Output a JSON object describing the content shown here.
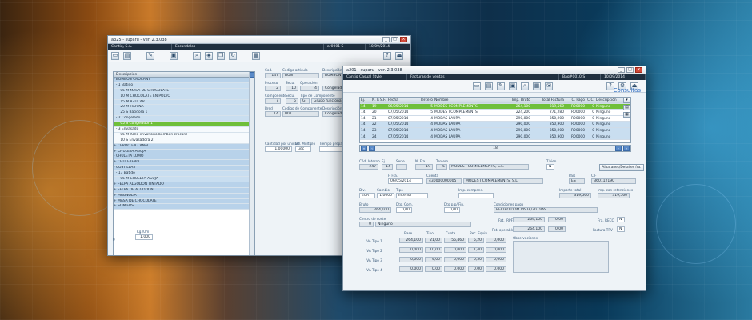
{
  "window1": {
    "title": "a325 - suparu - ver. 2.3.038",
    "info": [
      "Cantiq, S.A.",
      "Escandalos",
      "ar0001 S",
      "10/09/2014"
    ],
    "brand": "Consultas",
    "tree": {
      "header": "Descripción",
      "rows": [
        {
          "text": "- BOMBON CROCANT",
          "kind": "lvl0"
        },
        {
          "text": "  - 1 Batido",
          "kind": ""
        },
        {
          "text": "      05 M MASA DE CHOCOLATE",
          "kind": ""
        },
        {
          "text": "      10 M CHOCOLATE EN POLVO",
          "kind": ""
        },
        {
          "text": "      15 M AZUCAR",
          "kind": ""
        },
        {
          "text": "      20 M HARINA",
          "kind": ""
        },
        {
          "text": "      25 S Batidora 1",
          "kind": ""
        },
        {
          "text": "  - 2 Congelado",
          "kind": ""
        },
        {
          "text": "      05 S Congelador 1",
          "kind": "sel"
        },
        {
          "text": "  - 3 Envasado",
          "kind": "white"
        },
        {
          "text": "      05 M Rollo envoltorio bombon crocant",
          "kind": "white"
        },
        {
          "text": "      10 S Envasadora 2",
          "kind": "white"
        },
        {
          "text": "+ CERDO EN CANAL",
          "kind": "lvl0"
        },
        {
          "text": "+ CHULETA AGUJA",
          "kind": "lvl0"
        },
        {
          "text": "- CHULETA LOMO",
          "kind": "lvl0"
        },
        {
          "text": "+ CHULETERO",
          "kind": "lvl0"
        },
        {
          "text": "- COSTILLAS",
          "kind": "lvl0"
        },
        {
          "text": "  - 13 Batido",
          "kind": ""
        },
        {
          "text": "      05 M CHULETA AGUJA",
          "kind": ""
        },
        {
          "text": "+ FELPA ALGODON TINTADO",
          "kind": "lvl0"
        },
        {
          "text": "+ FELPA DE ALGODON",
          "kind": "lvl0"
        },
        {
          "text": "+ MAGNOLIA",
          "kind": "lvl0"
        },
        {
          "text": "+ MASA DE CHOCOLATE",
          "kind": "lvl0"
        },
        {
          "text": "+ SOMIERS",
          "kind": "lvl0"
        }
      ],
      "page": "25"
    },
    "fields": {
      "cod_label": "Cod.",
      "cod": "147",
      "codart_label": "Código artículo",
      "codart": "BON",
      "desc_label": "Descripción",
      "desc": "BOMBON CROCANT",
      "proceso_label": "Proceso",
      "proceso": "2",
      "secu_label": "Secu.",
      "secu": "10",
      "operacion_label": "Operación",
      "operacion_num": "4",
      "operacion": "Congelado",
      "componente_label": "Componente",
      "componente": "7",
      "secu2_label": "Secu.",
      "secu2": "5",
      "tipo_label": "Tipo de Componente",
      "tipo_num": "G",
      "tipo": "Grupo funcional hom",
      "bred_label": "Bred",
      "bred": "14",
      "codcomp_label": "Código de Componente",
      "codcomp": "001",
      "desccomp_label": "Descripción",
      "desccomp": "Congelador 1",
      "cant_label": "Cantidad por unidad",
      "cant": "1,00000",
      "ud_label": "Ud. Múltiplo",
      "ud": "udc",
      "tiempo_label": "Tiempo preparac.",
      "left_val": "0",
      "kg_label": "Kg./Um",
      "kg": "1,000"
    }
  },
  "window2": {
    "title": "a201 - suparu - ver. 2.3.038",
    "info": [
      "Cantiq Casual Style",
      "Facturas de ventas",
      "Bag#0010 S",
      "10/09/2014"
    ],
    "brand": "Consultas",
    "grid": {
      "head": [
        "Ej.",
        "N. Fac",
        "S.F.",
        "Fecha",
        "Tercero",
        "Nombre",
        "Imp. Bruto",
        "Total Factura",
        "C. Pago",
        "C.C.",
        "Descripción"
      ],
      "rows": [
        {
          "kind": "sel",
          "c": [
            "14",
            "19",
            "",
            "06/05/2014",
            "5",
            "MODES I COMPLEMENTS,",
            "264,100",
            "319,560",
            "R00000",
            "0",
            "Ninguno"
          ]
        },
        {
          "kind": "",
          "c": [
            "14",
            "20",
            "",
            "07/05/2014",
            "5",
            "MODES I COMPLEMENTS,",
            "224,200",
            "271,280",
            "R00000",
            "0",
            "Ninguno"
          ]
        },
        {
          "kind": "",
          "c": [
            "14",
            "21",
            "",
            "07/05/2014",
            "4",
            "MODAS LAURA",
            "290,000",
            "350,900",
            "R00000",
            "0",
            "Ninguno"
          ]
        },
        {
          "kind": "alt",
          "c": [
            "14",
            "22",
            "",
            "07/05/2014",
            "4",
            "MODAS LAURA",
            "290,000",
            "350,900",
            "R00000",
            "0",
            "Ninguno"
          ]
        },
        {
          "kind": "alt",
          "c": [
            "14",
            "23",
            "",
            "07/05/2014",
            "4",
            "MODAS LAURA",
            "290,000",
            "350,900",
            "R00000",
            "0",
            "Ninguno"
          ]
        },
        {
          "kind": "alt",
          "c": [
            "14",
            "24",
            "",
            "07/05/2014",
            "4",
            "MODAS LAURA",
            "290,000",
            "350,900",
            "R00000",
            "0",
            "Ninguno"
          ]
        }
      ],
      "page": "18"
    },
    "fields": {
      "cod_label": "Cód. Interno",
      "cod": "247",
      "ej_label": "Ej.",
      "ej": "14",
      "serie_label": "Serie",
      "nfra_label": "N. Fra.",
      "nfra": "19",
      "tercero_label": "Tercero",
      "tercero_num": "5",
      "tercero": "MODES I COMPLEMENTS, S.L.",
      "tbien_label": "T.bien",
      "tbien": "N",
      "albaranes_btn": "Albaranes/Detalles fra.",
      "ffra_label": "F. Fra.",
      "ffra": "06/05/2014",
      "cuenta_label": "Cuenta",
      "cuenta": "430000000005",
      "cuenta_name": "MODES I COMPLEMENTS, S.L.",
      "pais_label": "País",
      "pais": "ES",
      "cif_label": "CIF",
      "cif": "B60112190",
      "div_label": "Div.",
      "div": "EUR",
      "cambio_label": "Cambio",
      "cambio": "1,0000",
      "tipo_label": "Tipo",
      "tipo": "Interior",
      "impcompens_label": "Imp. compens.",
      "impfac_label": "Importe total",
      "impfac": "319,560",
      "impret_label": "Imp. con retenciones",
      "impret": "319,560",
      "bruto_label": "Bruto",
      "bruto": "264,100",
      "dtocom_label": "Dto. Com.",
      "dtocom": "0,00",
      "dtopp_label": "Dto p.p/ Fin.",
      "dtopp": "0,00",
      "condpago_label": "Condiciones pago",
      "condpago": "RECIBO DOM.VISTA/30 DIAS",
      "centro_label": "Centro de coste",
      "centro_num": "0",
      "centro": "Ninguno",
      "fijoirpf_label": "Fat. IRPF",
      "fijoirpf": "264,100",
      "fijoirpf_pct": "0,00",
      "frarecc_label": "Fra. RECC",
      "frarecc": "N",
      "fatoperable_label": "Fat. operable",
      "fatoperable": "264,100",
      "fatoperable_pct": "0,00",
      "facturatpv_label": "Factura TPV",
      "facturatpv": "N",
      "obs_label": "Observaciones",
      "iva_head": [
        "Base",
        "Tipo",
        "Cuota",
        "Rec. Equiv."
      ],
      "iva_rows": [
        {
          "label": "IVA Tipo 1",
          "base": "264,100",
          "tipo": "21,00",
          "cuota": "55,460",
          "rec": "5,20",
          "recv": "0,000"
        },
        {
          "label": "IVA Tipo 2",
          "base": "0,000",
          "tipo": "10,00",
          "cuota": "0,000",
          "rec": "1,40",
          "recv": "0,000"
        },
        {
          "label": "IVA Tipo 3",
          "base": "0,000",
          "tipo": "4,00",
          "cuota": "0,000",
          "rec": "0,50",
          "recv": "0,000"
        },
        {
          "label": "IVA Tipo 4",
          "base": "0,000",
          "tipo": "0,00",
          "cuota": "0,000",
          "rec": "0,00",
          "recv": "0,000"
        }
      ]
    }
  },
  "icons": [
    "folder-icon",
    "save-icon",
    "edit-icon",
    "delete-icon",
    "search-icon",
    "print-icon",
    "help-icon",
    "exit-icon"
  ]
}
